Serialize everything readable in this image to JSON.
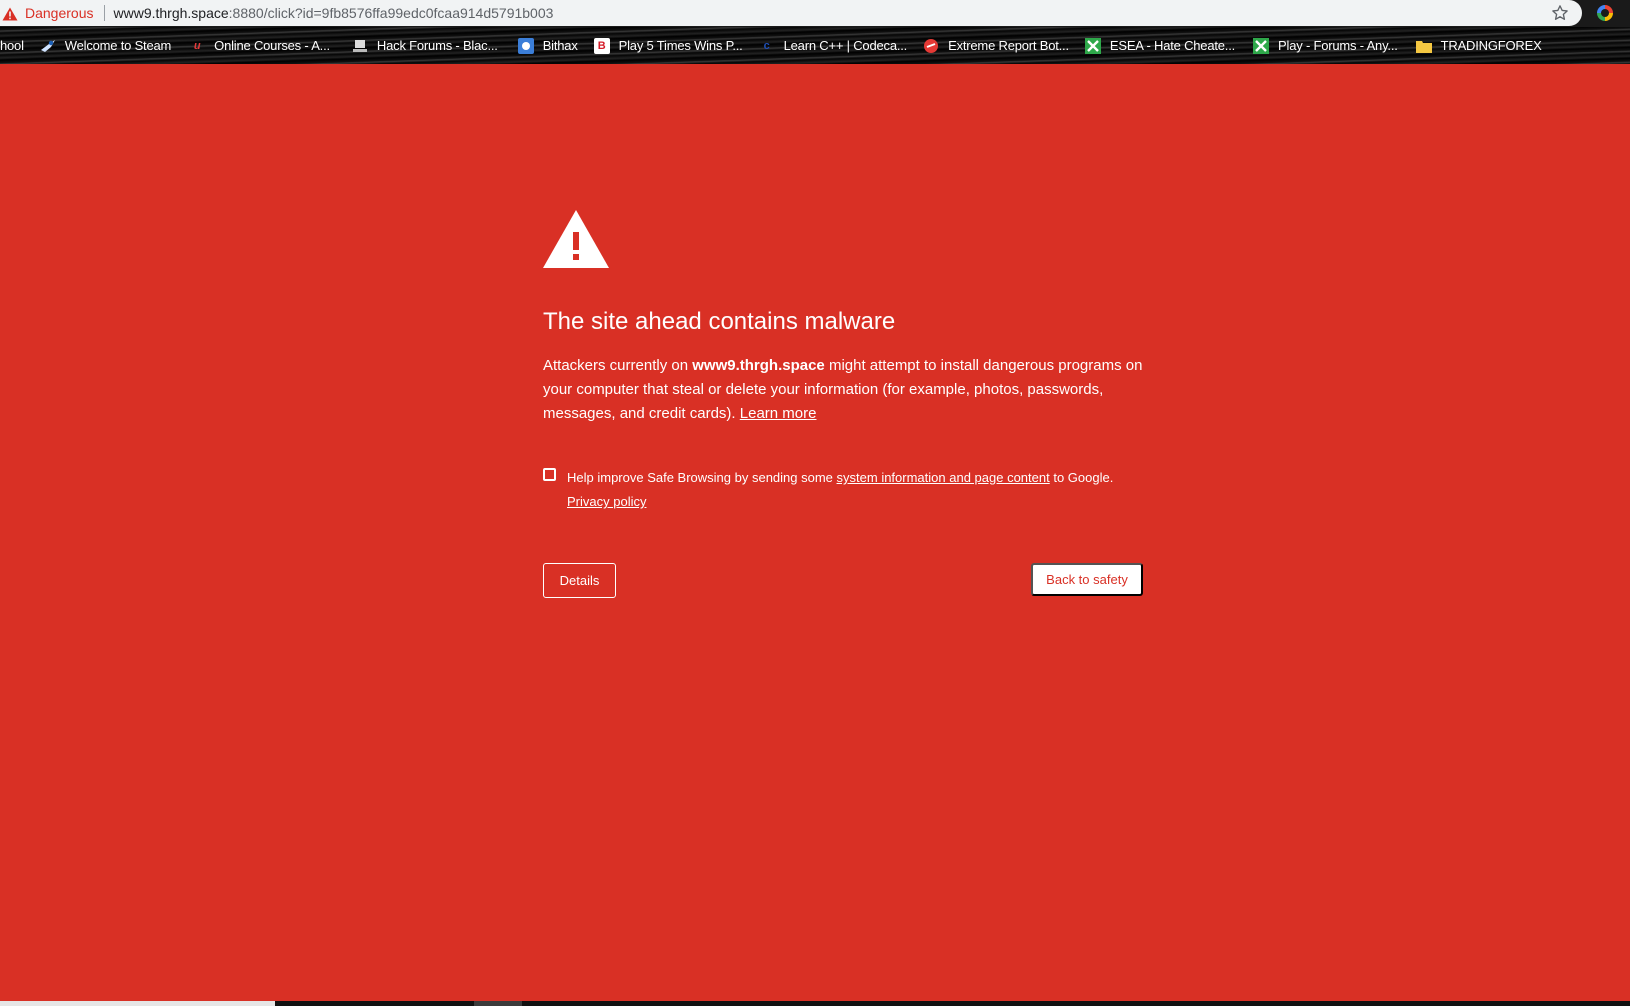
{
  "browser": {
    "security_label": "Dangerous",
    "url_host": "www9.thrgh.space",
    "url_rest": ":8880/click?id=9fb8576ffa99edc0fcaa914d5791b003",
    "star_icon": "star-outline-icon",
    "danger_icon": "warning-triangle-icon"
  },
  "bookmarks": [
    {
      "label": "hool",
      "icon": "none"
    },
    {
      "label": "Welcome to Steam",
      "icon": "steam-icon"
    },
    {
      "label": "Online Courses - A...",
      "icon": "udemy-icon"
    },
    {
      "label": "Hack Forums - Blac...",
      "icon": "hackforums-icon"
    },
    {
      "label": "Bithax",
      "icon": "bithax-icon"
    },
    {
      "label": "Play 5 Times Wins P...",
      "icon": "b-icon"
    },
    {
      "label": "Learn C++ | Codeca...",
      "icon": "codecademy-icon"
    },
    {
      "label": "Extreme Report Bot...",
      "icon": "reportbot-icon"
    },
    {
      "label": "ESEA - Hate Cheate...",
      "icon": "esea-icon"
    },
    {
      "label": "Play - Forums - Any...",
      "icon": "esea-icon"
    },
    {
      "label": "TRADINGFOREX",
      "icon": "folder-icon"
    }
  ],
  "interstitial": {
    "headline": "The site ahead contains malware",
    "body_before": "Attackers currently on ",
    "body_host": "www9.thrgh.space",
    "body_after": " might attempt to install dangerous programs on your computer that steal or delete your information (for example, photos, passwords, messages, and credit cards). ",
    "learn_more": "Learn more",
    "optin_before": "Help improve Safe Browsing by sending some ",
    "optin_link": "system information and page content",
    "optin_after": " to Google.",
    "privacy_policy": "Privacy policy",
    "details_button": "Details",
    "back_button": "Back to safety"
  },
  "colors": {
    "danger_red": "#d93025",
    "white": "#ffffff"
  }
}
